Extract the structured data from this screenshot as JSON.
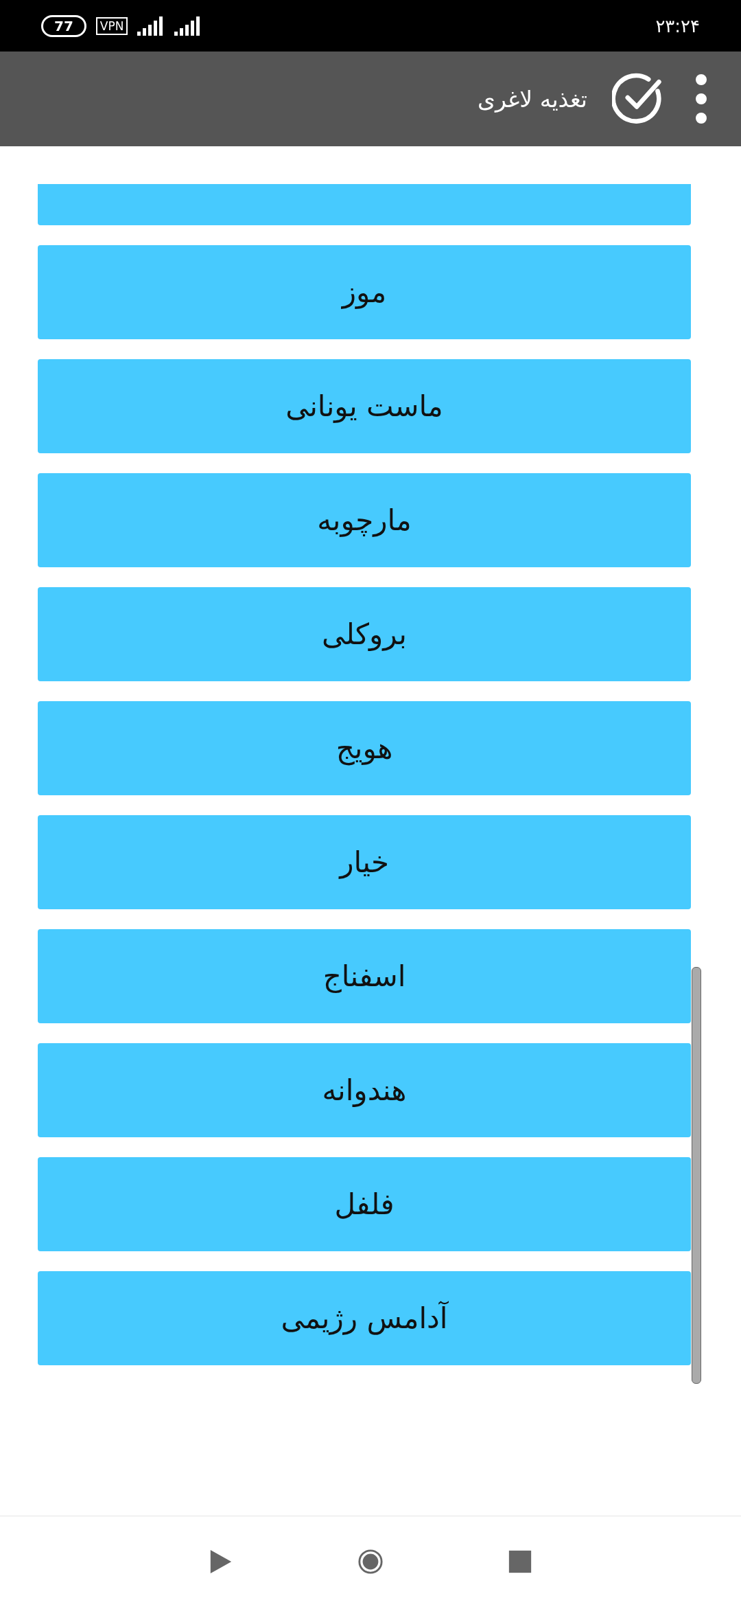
{
  "status_bar": {
    "time": "۲۳:۲۴",
    "battery": "77",
    "vpn": "VPN"
  },
  "app_bar": {
    "title": "تغذیه لاغری"
  },
  "list": {
    "items": [
      {
        "label": "موز"
      },
      {
        "label": "ماست یونانی"
      },
      {
        "label": "مارچوبه"
      },
      {
        "label": "بروکلی"
      },
      {
        "label": "هویج"
      },
      {
        "label": "خیار"
      },
      {
        "label": "اسفناج"
      },
      {
        "label": "هندوانه"
      },
      {
        "label": "فلفل"
      },
      {
        "label": "آدامس رژیمی"
      }
    ]
  }
}
